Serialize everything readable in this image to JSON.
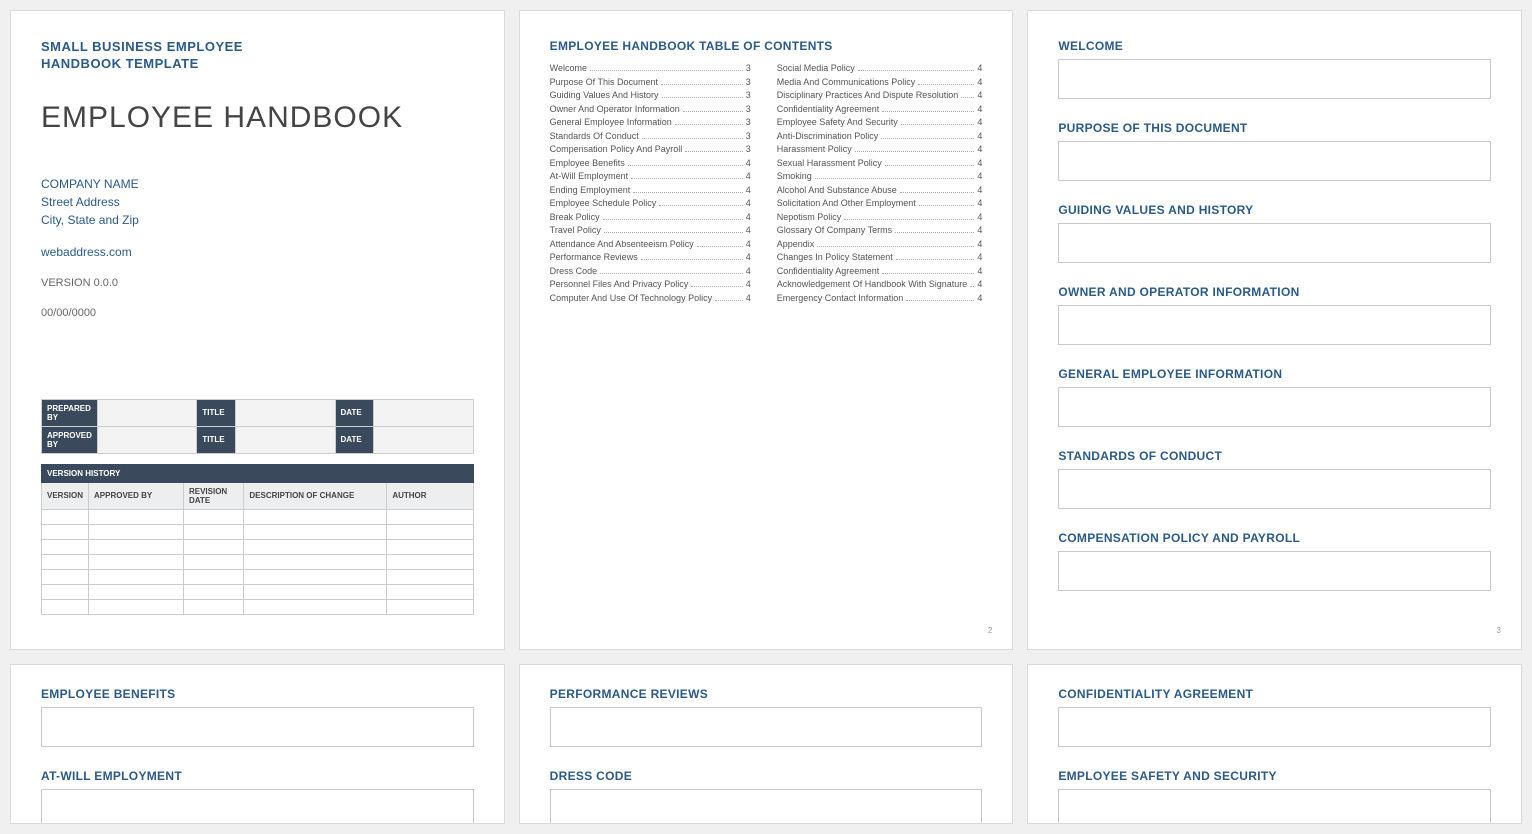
{
  "page1": {
    "subhead_l1": "SMALL BUSINESS EMPLOYEE",
    "subhead_l2": "HANDBOOK TEMPLATE",
    "title": "EMPLOYEE HANDBOOK",
    "company": "COMPANY NAME",
    "street": "Street Address",
    "citystate": "City, State and Zip",
    "web": "webaddress.com",
    "version": "VERSION 0.0.0",
    "date": "00/00/0000",
    "approval": {
      "r1c1": "PREPARED BY",
      "r1c2": "TITLE",
      "r1c3": "DATE",
      "r2c1": "APPROVED BY",
      "r2c2": "TITLE",
      "r2c3": "DATE"
    },
    "vh_header": "VERSION HISTORY",
    "vh_cols": {
      "c1": "VERSION",
      "c2": "APPROVED BY",
      "c3": "REVISION DATE",
      "c4": "DESCRIPTION OF CHANGE",
      "c5": "AUTHOR"
    }
  },
  "page2": {
    "title": "EMPLOYEE HANDBOOK TABLE OF CONTENTS",
    "left": [
      {
        "t": "Welcome",
        "p": "3"
      },
      {
        "t": "Purpose Of This Document",
        "p": "3"
      },
      {
        "t": "Guiding Values And History",
        "p": "3"
      },
      {
        "t": "Owner And Operator Information",
        "p": "3"
      },
      {
        "t": "General Employee Information",
        "p": "3"
      },
      {
        "t": "Standards Of Conduct",
        "p": "3"
      },
      {
        "t": "Compensation Policy And Payroll",
        "p": "3"
      },
      {
        "t": "Employee Benefits",
        "p": "4"
      },
      {
        "t": "At-Will Employment",
        "p": "4"
      },
      {
        "t": "Ending Employment",
        "p": "4"
      },
      {
        "t": "Employee Schedule Policy",
        "p": "4"
      },
      {
        "t": "Break Policy",
        "p": "4"
      },
      {
        "t": "Travel Policy",
        "p": "4"
      },
      {
        "t": "Attendance And Absenteeism Policy",
        "p": "4"
      },
      {
        "t": "Performance Reviews",
        "p": "4"
      },
      {
        "t": "Dress Code",
        "p": "4"
      },
      {
        "t": "Personnel Files And Privacy Policy",
        "p": "4"
      },
      {
        "t": "Computer And Use Of Technology Policy",
        "p": "4"
      }
    ],
    "right": [
      {
        "t": "Social Media Policy",
        "p": "4"
      },
      {
        "t": "Media And Communications Policy",
        "p": "4"
      },
      {
        "t": "Disciplinary Practices And Dispute Resolution",
        "p": "4"
      },
      {
        "t": "Confidentiality Agreement",
        "p": "4"
      },
      {
        "t": "Employee Safety And Security",
        "p": "4"
      },
      {
        "t": "Anti-Discrimination Policy",
        "p": "4"
      },
      {
        "t": "Harassment Policy",
        "p": "4"
      },
      {
        "t": "Sexual Harassment Policy",
        "p": "4"
      },
      {
        "t": "Smoking",
        "p": "4"
      },
      {
        "t": "Alcohol And Substance Abuse",
        "p": "4"
      },
      {
        "t": "Solicitation And Other Employment",
        "p": "4"
      },
      {
        "t": "Nepotism Policy",
        "p": "4"
      },
      {
        "t": "Glossary Of Company Terms",
        "p": "4"
      },
      {
        "t": "Appendix",
        "p": "4"
      },
      {
        "t": "Changes In Policy Statement",
        "p": "4"
      },
      {
        "t": "Confidentiality Agreement",
        "p": "4"
      },
      {
        "t": "Acknowledgement Of Handbook With Signature",
        "p": "4"
      },
      {
        "t": "Emergency Contact Information",
        "p": "4"
      }
    ],
    "pgnum": "2"
  },
  "page3": {
    "s1": "WELCOME",
    "s2": "PURPOSE OF THIS DOCUMENT",
    "s3": "GUIDING VALUES AND HISTORY",
    "s4": "OWNER AND OPERATOR INFORMATION",
    "s5": "GENERAL EMPLOYEE INFORMATION",
    "s6": "STANDARDS OF CONDUCT",
    "s7": "COMPENSATION POLICY AND PAYROLL",
    "pgnum": "3"
  },
  "page4": {
    "s1": "EMPLOYEE BENEFITS",
    "s2": "AT-WILL EMPLOYMENT"
  },
  "page5": {
    "s1": "PERFORMANCE REVIEWS",
    "s2": "DRESS CODE"
  },
  "page6": {
    "s1": "CONFIDENTIALITY AGREEMENT",
    "s2": "EMPLOYEE SAFETY AND SECURITY"
  }
}
